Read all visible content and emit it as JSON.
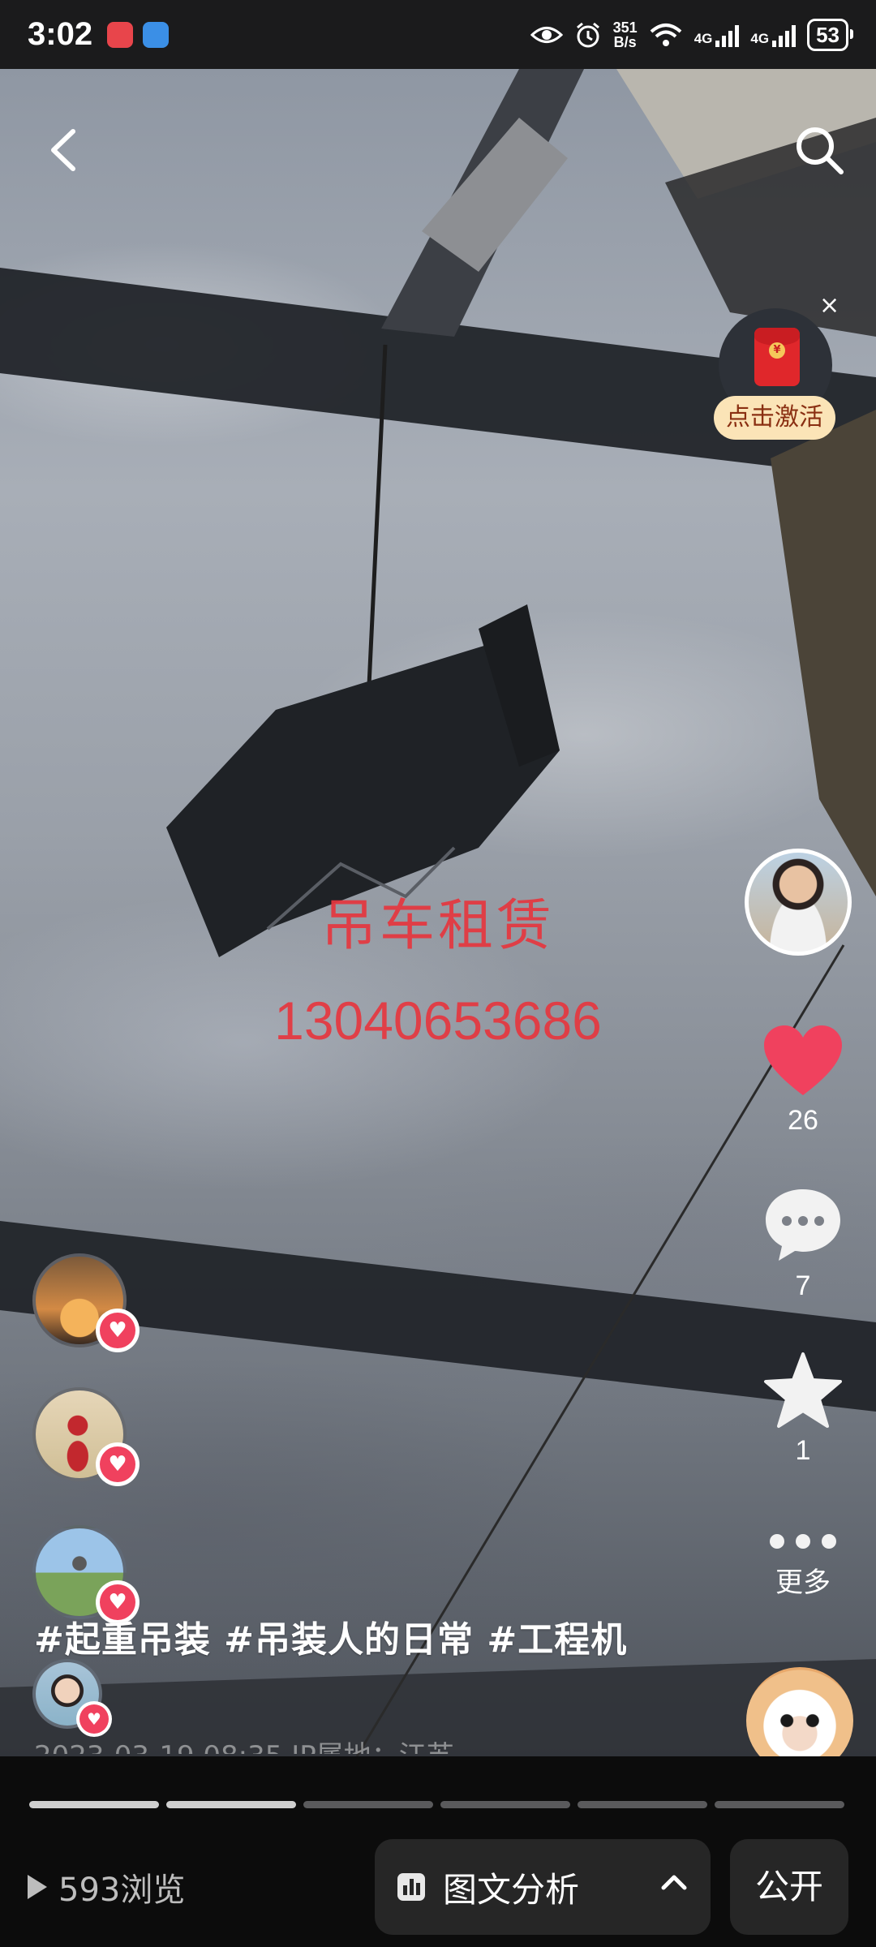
{
  "status_bar": {
    "time": "3:02",
    "net_speed_top": "351",
    "net_speed_bottom": "B/s",
    "sim1_label": "4G",
    "sim2_label": "4G",
    "battery": "53"
  },
  "top_bar": {
    "back_icon": "back-arrow-icon",
    "search_icon": "search-icon"
  },
  "red_packet": {
    "label": "点击激活",
    "coin": "¥",
    "close": "×"
  },
  "video_overlay": {
    "title": "吊车租赁",
    "phone": "13040653686"
  },
  "actions": {
    "like_count": "26",
    "comment_count": "7",
    "favorite_count": "1",
    "more_label": "更多",
    "like_color": "#f0415e"
  },
  "viewers": [
    {
      "name": "viewer-1"
    },
    {
      "name": "viewer-2"
    },
    {
      "name": "viewer-3"
    },
    {
      "name": "viewer-4"
    }
  ],
  "caption": {
    "hashtags": "#起重吊装 #吊装人的日常 #工程机",
    "dateline": "2023-03-19 08:35 IP属地：江苏"
  },
  "carousel": {
    "total_pages": 6,
    "current_page": 2
  },
  "bottom_bar": {
    "views": "593浏览",
    "analysis_label": "图文分析",
    "public_label": "公开"
  }
}
